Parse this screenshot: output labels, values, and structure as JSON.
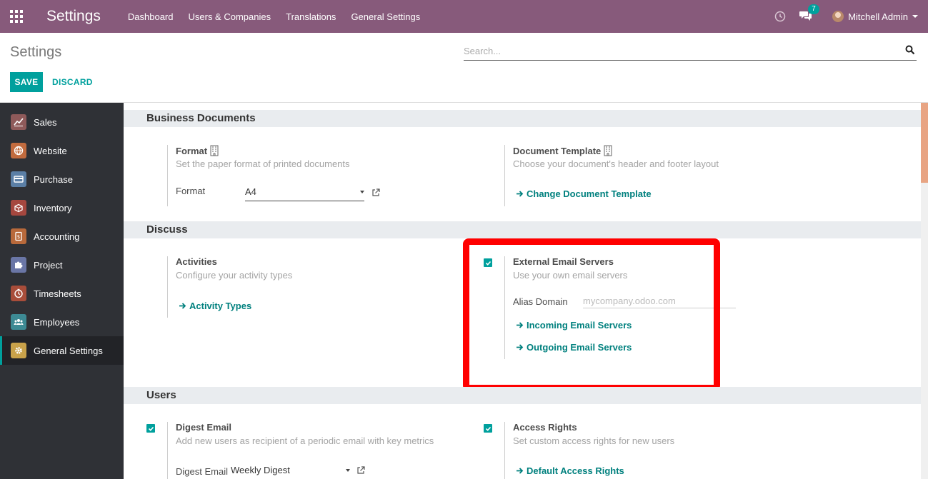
{
  "navbar": {
    "brand": "Settings",
    "menu": [
      "Dashboard",
      "Users & Companies",
      "Translations",
      "General Settings"
    ],
    "chat_count": "7",
    "user_name": "Mitchell Admin"
  },
  "control_panel": {
    "title": "Settings",
    "search_placeholder": "Search...",
    "save_label": "SAVE",
    "discard_label": "DISCARD"
  },
  "sidebar": {
    "items": [
      {
        "label": "Sales",
        "icon": "sales-icon",
        "color": "#8f5a5a"
      },
      {
        "label": "Website",
        "icon": "website-icon",
        "color": "#c26b3e"
      },
      {
        "label": "Purchase",
        "icon": "purchase-icon",
        "color": "#5b7fa6"
      },
      {
        "label": "Inventory",
        "icon": "inventory-icon",
        "color": "#a5473f"
      },
      {
        "label": "Accounting",
        "icon": "accounting-icon",
        "color": "#b8693b"
      },
      {
        "label": "Project",
        "icon": "project-icon",
        "color": "#6a76a6"
      },
      {
        "label": "Timesheets",
        "icon": "timesheets-icon",
        "color": "#a84d3a"
      },
      {
        "label": "Employees",
        "icon": "employees-icon",
        "color": "#3d8a94"
      },
      {
        "label": "General Settings",
        "icon": "gear-icon",
        "color": "#c9a24a"
      }
    ],
    "active_index": 8
  },
  "sections": {
    "business_documents": {
      "title": "Business Documents",
      "format": {
        "title": "Format",
        "description": "Set the paper format of printed documents",
        "field_label": "Format",
        "value": "A4"
      },
      "document_template": {
        "title": "Document Template",
        "description": "Choose your document's header and footer layout",
        "link": "Change Document Template"
      }
    },
    "discuss": {
      "title": "Discuss",
      "activities": {
        "title": "Activities",
        "description": "Configure your activity types",
        "link": "Activity Types"
      },
      "external_email": {
        "title": "External Email Servers",
        "description": "Use your own email servers",
        "alias_label": "Alias Domain",
        "alias_placeholder": "mycompany.odoo.com",
        "incoming_link": "Incoming Email Servers",
        "outgoing_link": "Outgoing Email Servers",
        "checked": true
      }
    },
    "users": {
      "title": "Users",
      "digest": {
        "title": "Digest Email",
        "description": "Add new users as recipient of a periodic email with key metrics",
        "field_label": "Digest Email",
        "value": "Weekly Digest",
        "checked": true
      },
      "access_rights": {
        "title": "Access Rights",
        "description": "Set custom access rights for new users",
        "link": "Default Access Rights",
        "checked": true
      }
    }
  },
  "colors": {
    "navbar": "#875a7b",
    "accent": "#00a09d",
    "link": "#00807e",
    "highlight": "#ff0000"
  }
}
